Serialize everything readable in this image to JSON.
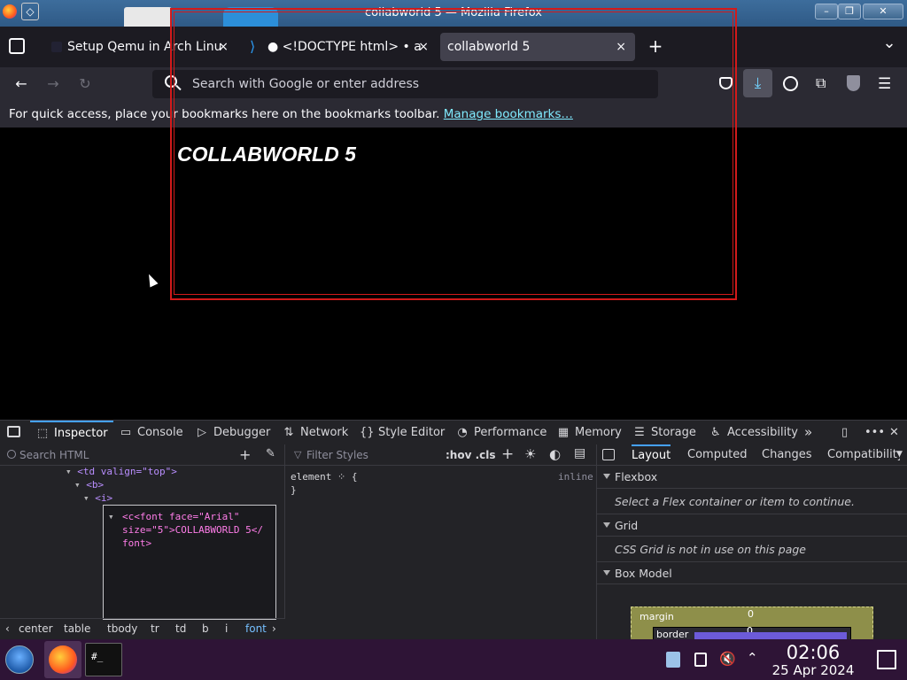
{
  "window": {
    "title": "collabworld 5 — Mozilla Firefox"
  },
  "tabs": [
    {
      "label": "Setup Qemu in Arch Linu",
      "close": "×"
    },
    {
      "label": "● <!DOCTYPE html> • a",
      "close": "×"
    },
    {
      "label": "collabworld 5",
      "close": "×"
    }
  ],
  "toolbar": {
    "new_tab": "+",
    "list_tabs": "⌄",
    "back": "←",
    "forward": "→",
    "reload": "↻"
  },
  "urlbar": {
    "placeholder": "Search with Google or enter address"
  },
  "bookmarks_bar": {
    "text": "For quick access, place your bookmarks here on the bookmarks toolbar.",
    "link": "Manage bookmarks…"
  },
  "page": {
    "heading": "COLLABWORLD 5"
  },
  "devtools": {
    "tabs": [
      "Inspector",
      "Console",
      "Debugger",
      "Network",
      "Style Editor",
      "Performance",
      "Memory",
      "Storage",
      "Accessibility"
    ],
    "search_placeholder": "Search HTML",
    "markup": {
      "line1": "<td valign=\"top\">",
      "line2": "<b>",
      "line3": "<i>",
      "edit_line1": "<c<font face=\"Arial\"",
      "edit_line2": "size=\"5\">COLLABWORLD 5</",
      "edit_line3": "font>"
    },
    "breadcrumbs": [
      "center",
      "table",
      "tbody",
      "tr",
      "td",
      "b",
      "i",
      "font"
    ],
    "rules": {
      "filter_placeholder": "Filter Styles",
      "hov_cls": ":hov .cls",
      "rule_selector": "element",
      "rule_open": "{",
      "rule_close": "}",
      "rule_source": "inline"
    },
    "side_tabs": [
      "Layout",
      "Computed",
      "Changes",
      "Compatibility"
    ],
    "layout": {
      "flexbox_title": "Flexbox",
      "flexbox_note": "Select a Flex container or item to continue.",
      "grid_title": "Grid",
      "grid_note": "CSS Grid is not in use on this page",
      "boxmodel_title": "Box Model",
      "margin_label": "margin",
      "margin_value": "0",
      "border_label": "border",
      "border_value": "0"
    }
  },
  "taskbar": {
    "time": "02:06",
    "date": "25 Apr 2024"
  },
  "colors": {
    "accent": "#45a1ff",
    "link": "#80ebff",
    "frame_border": "#d21a1a",
    "taskbar": "#2e1436"
  }
}
